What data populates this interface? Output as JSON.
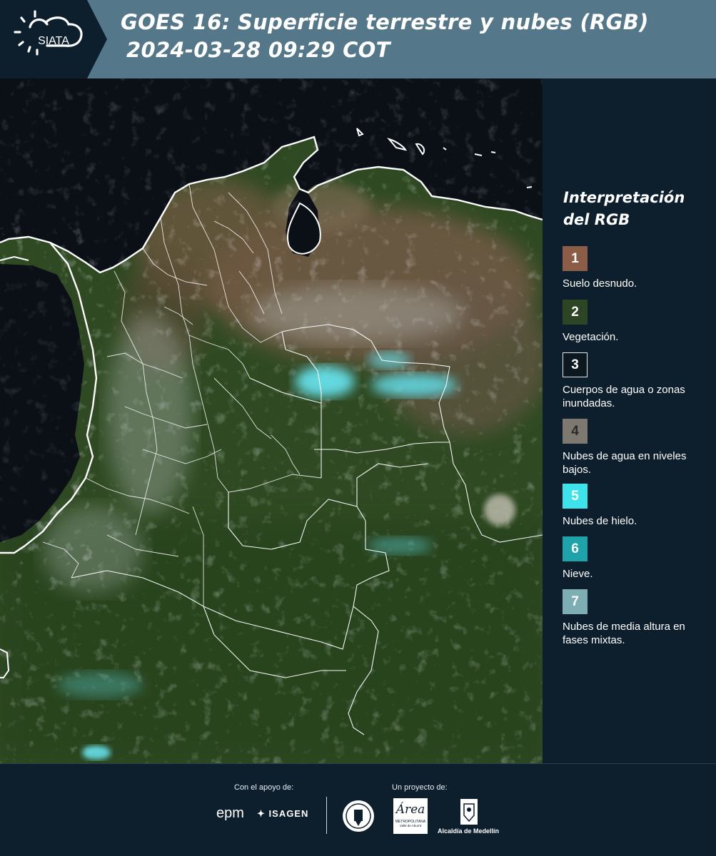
{
  "header": {
    "logo_text": "SIATA",
    "title_line1": "GOES 16: Superficie terrestre y nubes (RGB)",
    "title_line2": "2024-03-28 09:29 COT"
  },
  "map": {
    "image": "satellite-rgb-composite-colombia",
    "colors": {
      "ocean": "#0a1016",
      "vegetation": "#2f4a22",
      "bare_soil": "#6f5a44",
      "ice_cloud": "#66e0ea",
      "low_cloud": "#b9bfc0",
      "borders": "#ffffff"
    }
  },
  "legend": {
    "title": "Interpretación del RGB",
    "items": [
      {
        "number": "1",
        "label": "Suelo desnudo.",
        "color": "#8b5d46"
      },
      {
        "number": "2",
        "label": "Vegetación.",
        "color": "#2d4523"
      },
      {
        "number": "3",
        "label": "Cuerpos de agua o zonas inundadas.",
        "color": "#0c1820"
      },
      {
        "number": "4",
        "label": "Nubes de agua en niveles bajos.",
        "color": "#7d7870"
      },
      {
        "number": "5",
        "label": "Nubes de hielo.",
        "color": "#3ee2ea"
      },
      {
        "number": "6",
        "label": "Nieve.",
        "color": "#1fa3ab"
      },
      {
        "number": "7",
        "label": "Nubes de media altura en fases mixtas.",
        "color": "#7caeb3"
      }
    ]
  },
  "footer": {
    "support_caption": "Con el apoyo de:",
    "project_caption": "Un proyecto de:",
    "logos": {
      "epm": "epm",
      "isagen": "ISAGEN",
      "area_metro": "Área",
      "area_metro_sub": "METROPOLITANA",
      "area_metro_sub2": "Valle de Aburrá",
      "alcaldia": "Alcaldía de Medellín"
    }
  }
}
